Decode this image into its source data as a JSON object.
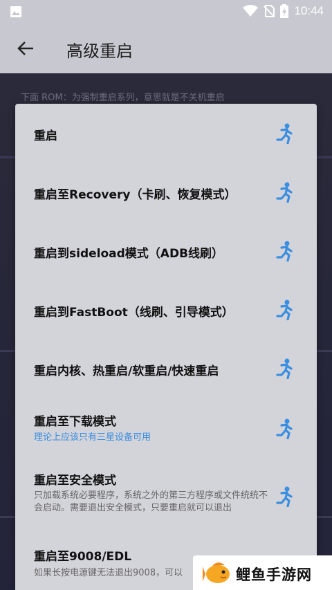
{
  "status_bar": {
    "time": "10:44"
  },
  "app_bar": {
    "title": "高级重启"
  },
  "background_hint": "下面 ROM：为强制重启系列，意思就是不关机重启",
  "dialog": {
    "items": [
      {
        "label": "重启"
      },
      {
        "label": "重启至Recovery（卡刷、恢复模式）"
      },
      {
        "label": "重启到sideload模式（ADB线刷）"
      },
      {
        "label": "重启到FastBoot（线刷、引导模式）"
      },
      {
        "label": "重启内核、热重启/软重启/快速重启"
      },
      {
        "label": "重启至下载模式",
        "desc": "理论上应该只有三星设备可用"
      },
      {
        "label": "重启至安全模式",
        "desc": "只加载系统必要程序，系统之外的第三方程序或文件统统不会启动。需要退出安全模式，只要重启就可以退出"
      },
      {
        "label": "重启至9008/EDL",
        "desc": "如果长按电源键无法退出9008，可以"
      }
    ]
  },
  "watermark": {
    "text": "鲤鱼手游网"
  },
  "colors": {
    "accent": "#3a8ee0",
    "dialog_bg": "#d3d3da"
  }
}
